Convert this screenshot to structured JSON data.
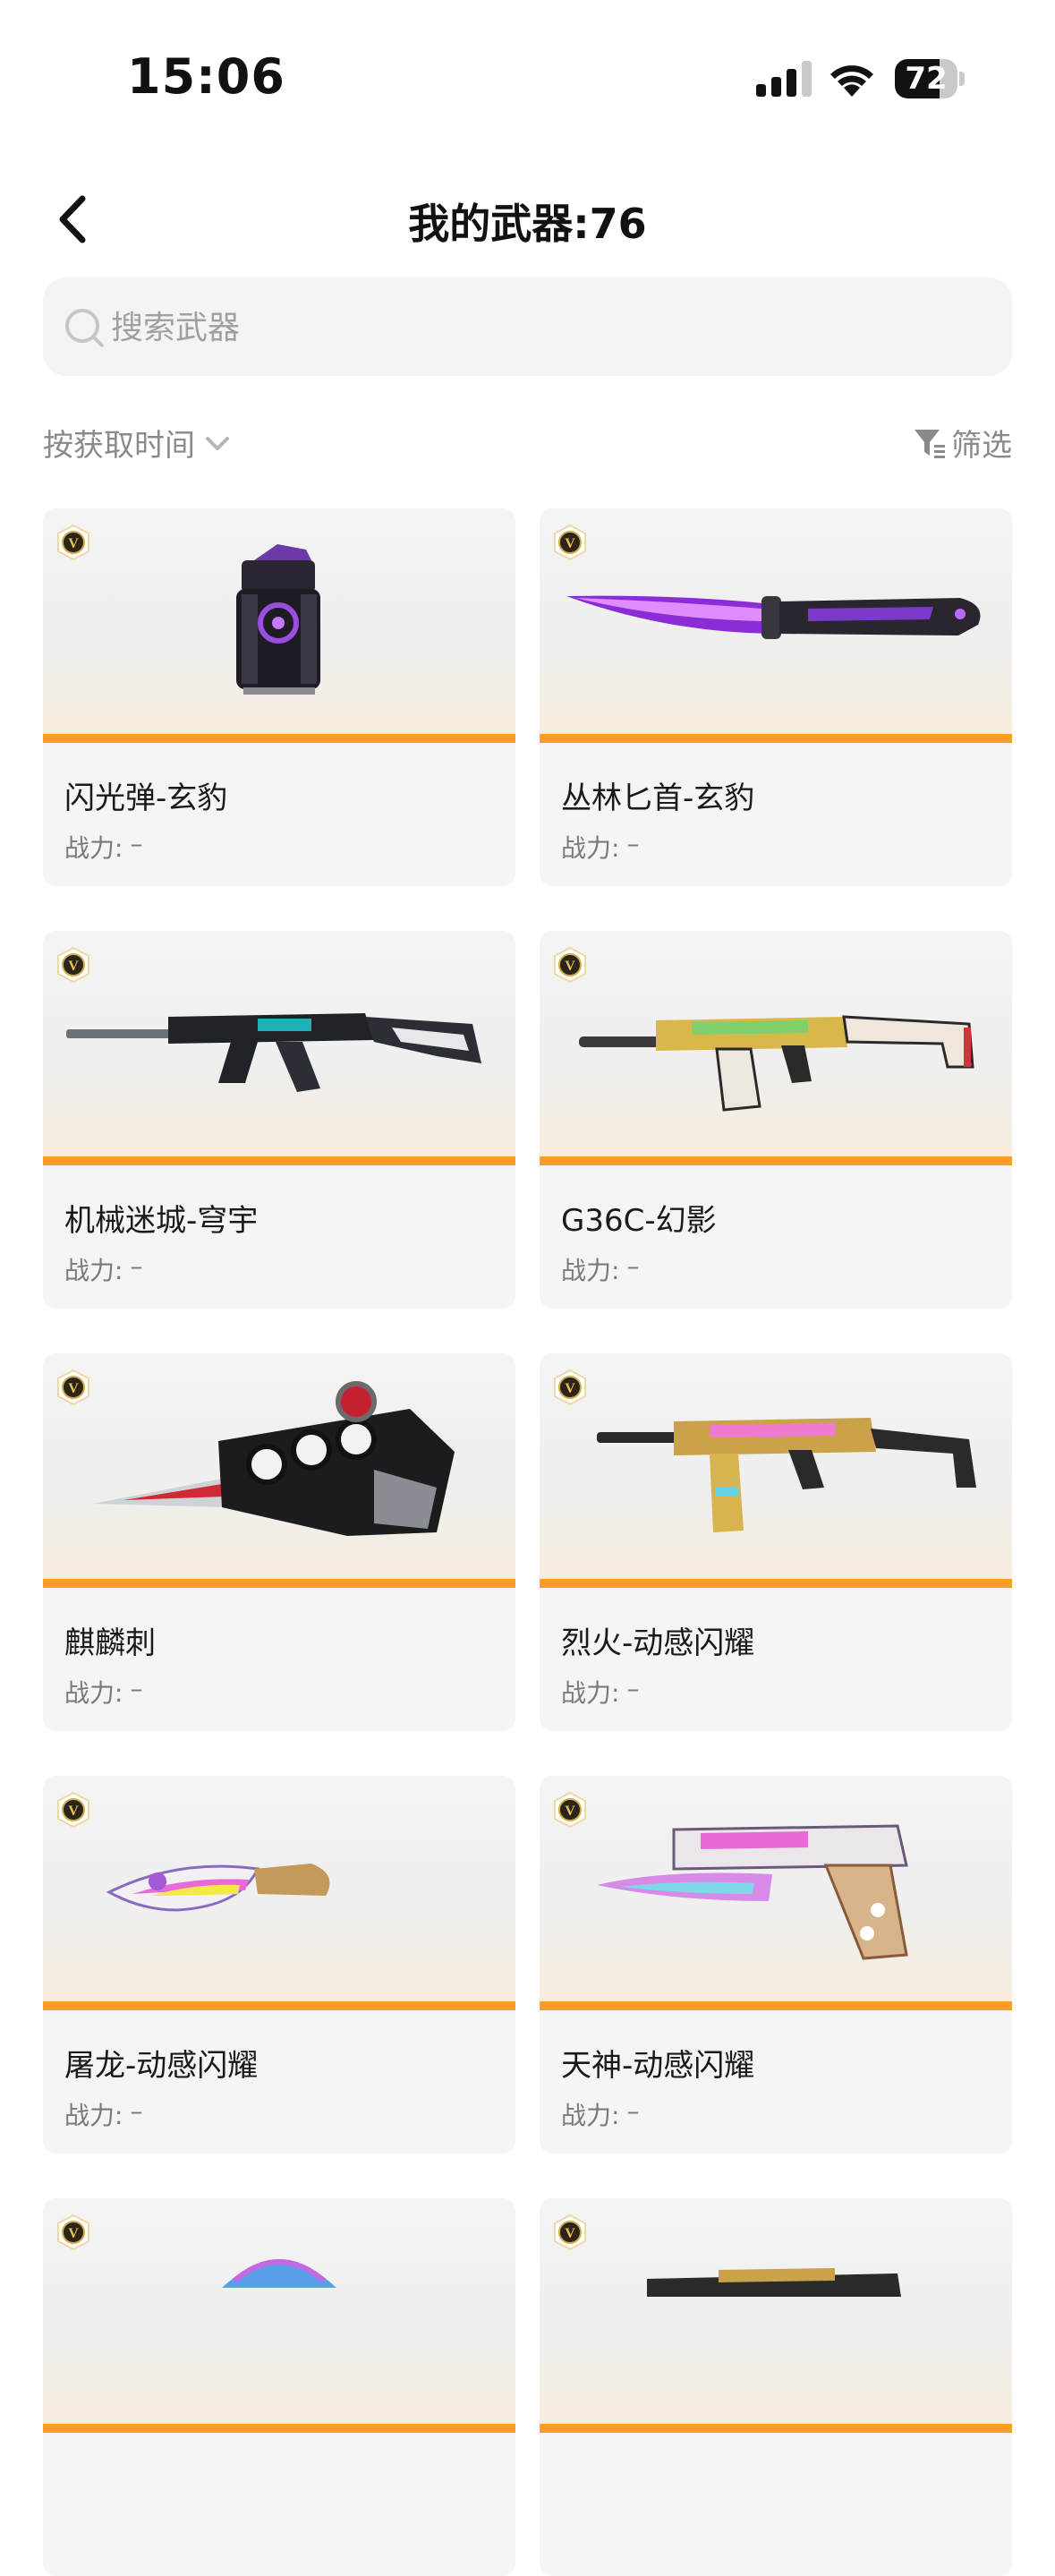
{
  "status": {
    "time": "15:06",
    "battery": "72",
    "battery_level_percent": 72
  },
  "nav": {
    "title": "我的武器:76"
  },
  "search": {
    "placeholder": "搜索武器"
  },
  "toolbar": {
    "sort_label": "按获取时间",
    "filter_label": "筛选"
  },
  "colors": {
    "accent": "#f4a024",
    "background": "#ffffff",
    "card": "#f5f5f5"
  },
  "weapons": [
    {
      "name": "闪光弹-玄豹",
      "power_label": "战力:",
      "power_value": "–",
      "badge": "V",
      "art": "flashbang-icon"
    },
    {
      "name": "丛林匕首-玄豹",
      "power_label": "战力:",
      "power_value": "–",
      "badge": "V",
      "art": "knife-icon"
    },
    {
      "name": "机械迷城-穹宇",
      "power_label": "战力:",
      "power_value": "–",
      "badge": "V",
      "art": "rifle-icon"
    },
    {
      "name": "G36C-幻影",
      "power_label": "战力:",
      "power_value": "–",
      "badge": "V",
      "art": "rifle-icon"
    },
    {
      "name": "麒麟刺",
      "power_label": "战力:",
      "power_value": "–",
      "badge": "V",
      "art": "knuckle-knife-icon"
    },
    {
      "name": "烈火-动感闪耀",
      "power_label": "战力:",
      "power_value": "–",
      "badge": "V",
      "art": "smg-icon"
    },
    {
      "name": "屠龙-动感闪耀",
      "power_label": "战力:",
      "power_value": "–",
      "badge": "V",
      "art": "blade-icon"
    },
    {
      "name": "天神-动感闪耀",
      "power_label": "战力:",
      "power_value": "–",
      "badge": "V",
      "art": "pistol-icon"
    },
    {
      "name": "",
      "power_label": "",
      "power_value": "",
      "badge": "V",
      "art": "grenade-icon"
    },
    {
      "name": "",
      "power_label": "",
      "power_value": "",
      "badge": "V",
      "art": "rifle-icon"
    }
  ]
}
